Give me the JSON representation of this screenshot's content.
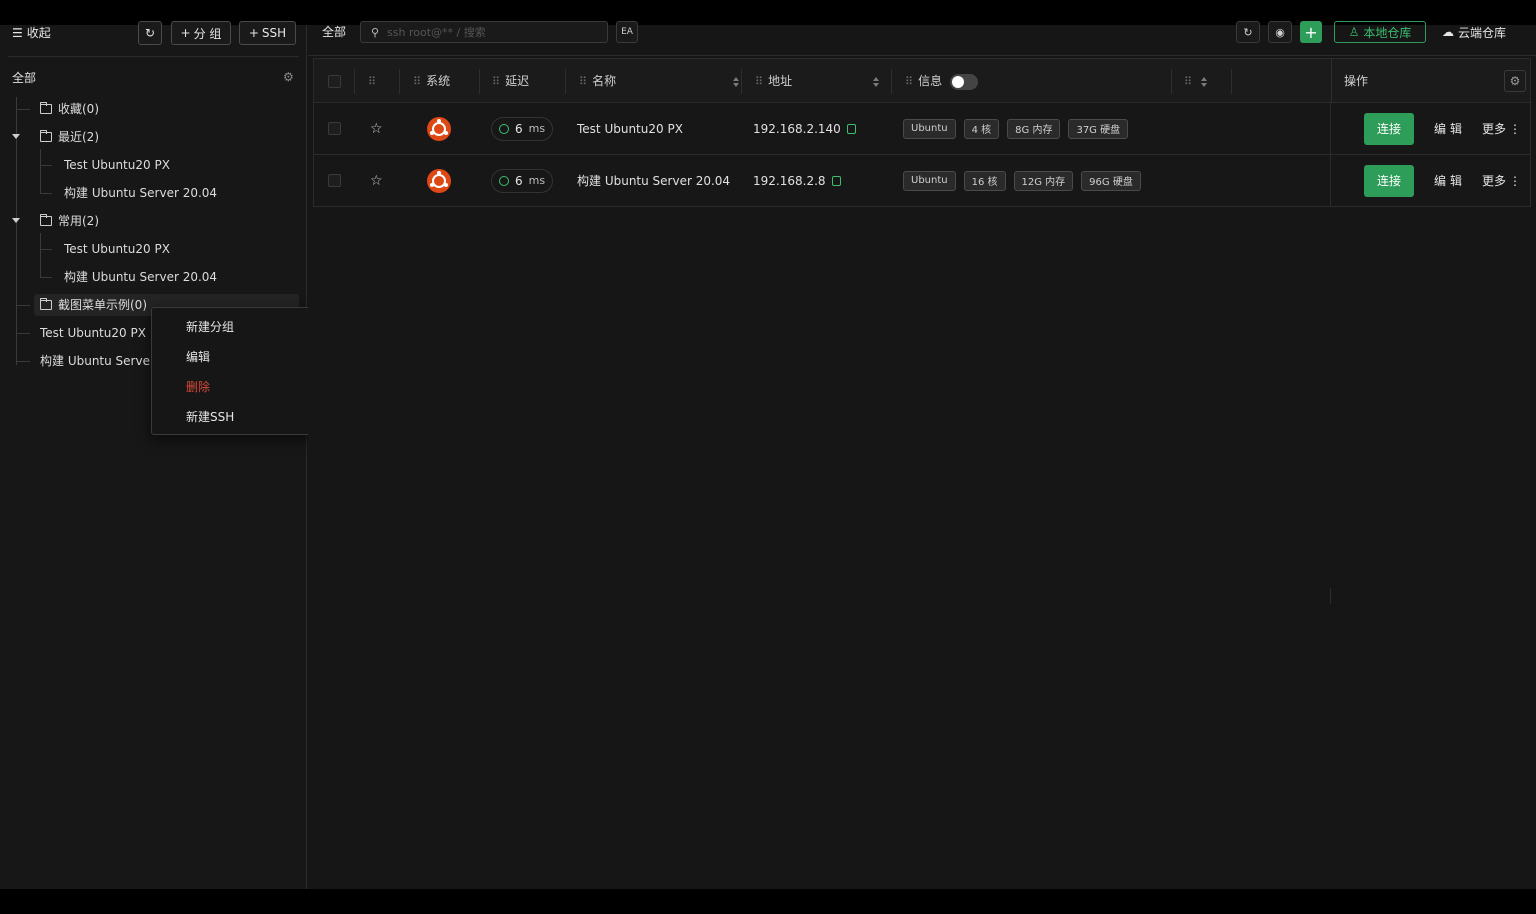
{
  "sidebar": {
    "collapse_label": "收起",
    "add_group_label": "分 组",
    "add_ssh_label": "SSH",
    "all_label": "全部",
    "tree": [
      {
        "label": "收藏(0)"
      },
      {
        "label": "最近(2)",
        "children": [
          "Test Ubuntu20 PX",
          "构建 Ubuntu Server 20.04"
        ]
      },
      {
        "label": "常用(2)",
        "children": [
          "Test Ubuntu20 PX",
          "构建 Ubuntu Server 20.04"
        ]
      },
      {
        "label": "截图菜单示例(0)"
      }
    ],
    "loose_hosts": [
      "Test Ubuntu20 PX",
      "构建 Ubuntu Server"
    ]
  },
  "context_menu": {
    "items": [
      {
        "label": "新建分组"
      },
      {
        "label": "编辑"
      },
      {
        "label": "删除",
        "danger": true
      },
      {
        "label": "新建SSH"
      }
    ]
  },
  "topbar": {
    "breadcrumb": "全部",
    "search_placeholder": "ssh root@** / 搜索",
    "local_repo_label": "本地仓库",
    "cloud_repo_label": "云端仓库"
  },
  "table": {
    "headers": {
      "system": "系统",
      "latency": "延迟",
      "name": "名称",
      "address": "地址",
      "info": "信息",
      "ops": "操作"
    },
    "rows": [
      {
        "latency": "6",
        "latency_unit": "ms",
        "name": "Test Ubuntu20 PX",
        "address": "192.168.2.140",
        "tags": [
          "Ubuntu",
          "4 核",
          "8G 内存",
          "37G 硬盘"
        ],
        "connect_label": "连接",
        "edit_label": "编辑",
        "more_label": "更多"
      },
      {
        "latency": "6",
        "latency_unit": "ms",
        "name": "构建 Ubuntu Server 20.04",
        "address": "192.168.2.8",
        "tags": [
          "Ubuntu",
          "16 核",
          "12G 内存",
          "96G 硬盘"
        ],
        "connect_label": "连接",
        "edit_label": "编辑",
        "more_label": "更多"
      }
    ]
  },
  "colors": {
    "accent": "#2e9d5a",
    "danger": "#d94a3a",
    "ubuntu": "#dd4814"
  }
}
